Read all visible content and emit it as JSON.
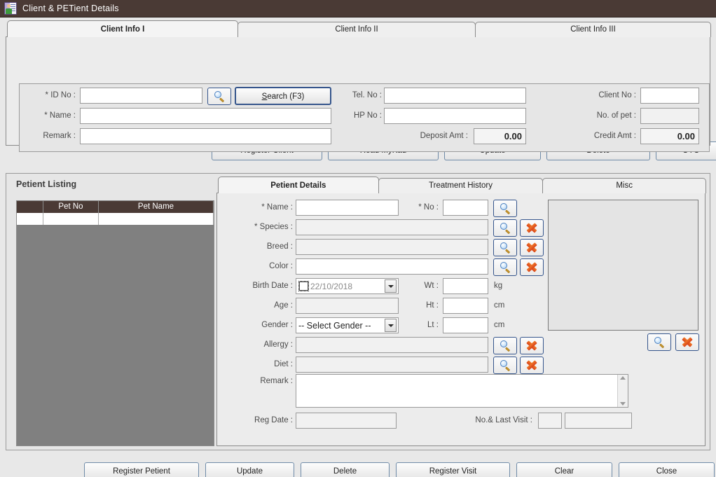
{
  "window": {
    "title": "Client & PETient Details",
    "icon": "contact-card-icon"
  },
  "client_tabs": [
    {
      "label": "Client Info I",
      "active": true
    },
    {
      "label": "Client Info II",
      "active": false
    },
    {
      "label": "Client Info III",
      "active": false
    }
  ],
  "client_form": {
    "id_no_label": "* ID No :",
    "id_no_value": "",
    "name_label": "* Name :",
    "name_value": "",
    "remark_label": "Remark :",
    "remark_value": "",
    "search_icon": "magnifier-icon",
    "search_button": "Search (F3)",
    "tel_no_label": "Tel. No :",
    "tel_no_value": "",
    "hp_no_label": "HP No :",
    "hp_no_value": "",
    "deposit_amt_label": "Deposit Amt :",
    "deposit_amt_value": "0.00",
    "client_no_label": "Client No :",
    "client_no_value": "",
    "no_of_pet_label": "No. of pet :",
    "no_of_pet_value": "",
    "credit_amt_label": "Credit Amt :",
    "credit_amt_value": "0.00"
  },
  "client_buttons": [
    "Register Client",
    "Read MyKad",
    "Update",
    "Delete",
    "OTC"
  ],
  "petient_listing": {
    "title": "Petient Listing",
    "columns": [
      "",
      "Pet No",
      "Pet Name"
    ],
    "rows": [
      {
        "marker": "",
        "pet_no": "",
        "pet_name": ""
      }
    ]
  },
  "petient_tabs": [
    {
      "label": "Petient Details",
      "active": true
    },
    {
      "label": "Treatment History",
      "active": false
    },
    {
      "label": "Misc",
      "active": false
    }
  ],
  "petient_form": {
    "name_label": "* Name :",
    "name_value": "",
    "no_label": "* No :",
    "no_value": "",
    "species_label": "* Species :",
    "species_value": "",
    "breed_label": "Breed :",
    "breed_value": "",
    "color_label": "Color :",
    "color_value": "",
    "birth_date_label": "Birth Date :",
    "birth_date_value": "22/10/2018",
    "birth_date_checked": false,
    "age_label": "Age :",
    "age_value": "",
    "gender_label": "Gender :",
    "gender_value": "-- Select Gender --",
    "wt_label": "Wt :",
    "wt_value": "",
    "wt_unit": "kg",
    "ht_label": "Ht :",
    "ht_value": "",
    "ht_unit": "cm",
    "lt_label": "Lt :",
    "lt_value": "",
    "lt_unit": "cm",
    "allergy_label": "Allergy :",
    "allergy_value": "",
    "diet_label": "Diet :",
    "diet_value": "",
    "remark_label": "Remark :",
    "remark_value": "",
    "reg_date_label": "Reg Date :",
    "reg_date_value": "",
    "visit_label": "No.& Last  Visit :",
    "visit_no_value": "",
    "visit_last_value": "",
    "lookup_icon": "magnifier-icon",
    "clear_icon": "orange-dart-icon"
  },
  "petient_buttons": [
    "Register Petient",
    "Update",
    "Delete",
    "Register Visit",
    "Clear",
    "Close"
  ],
  "colors": {
    "titlebar": "#4a3a35",
    "grid_header": "#4a3a35",
    "window_bg": "#e8e8e8",
    "panel_bg": "#ececec",
    "accent_button_border": "#35558c",
    "dart": "#e05a20"
  }
}
